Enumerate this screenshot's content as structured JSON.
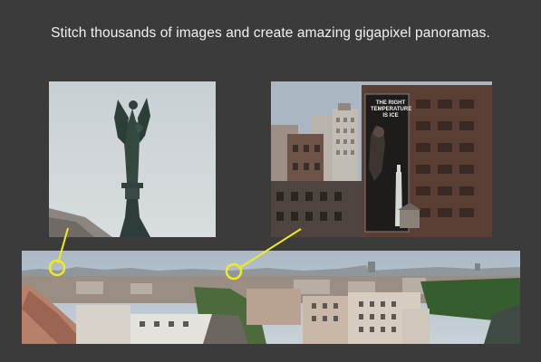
{
  "headline": "Stitch thousands of images and create amazing gigapixel panoramas.",
  "billboard": {
    "text_lines": [
      "THE RIGHT",
      "TEMPERATURE",
      "IS ICE"
    ]
  },
  "colors": {
    "background": "#3b3b3b",
    "headline_text": "#f2f2f2",
    "callout": "#f2ea1c"
  }
}
